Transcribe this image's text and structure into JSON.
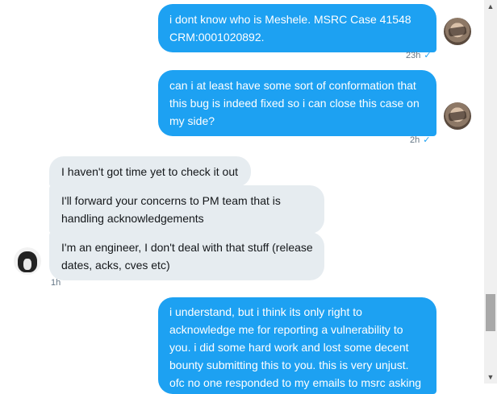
{
  "messages": {
    "sent_1": {
      "text": "i dont know who is Meshele. MSRC Case 41548 CRM:0001020892.",
      "time": "23h"
    },
    "sent_2": {
      "text": "can i at least have some sort of conformation that this bug is indeed fixed so i can close this case on my side?",
      "time": "2h"
    },
    "recv_1": {
      "text": "I haven't got time yet to check it out"
    },
    "recv_2": {
      "text": "I'll forward your concerns to PM team that is handling acknowledgements"
    },
    "recv_3": {
      "text": "I'm an engineer, I don't deal with that stuff (release dates, acks, cves etc)",
      "time": "1h"
    },
    "sent_3": {
      "text": "i understand, but i think its only right to acknowledge me for reporting a vulnerability to you. i did some hard work and lost some decent bounty submitting this to you. this is very unjust. ofc no one responded to my emails to msrc asking"
    }
  },
  "icons": {
    "read_receipt": "checkmark-icon",
    "scroll_up": "arrow-up-icon",
    "scroll_down": "arrow-down-icon"
  },
  "colors": {
    "sent_bubble": "#1da1f2",
    "received_bubble": "#e6ecf0",
    "read_check": "#1da1f2"
  }
}
